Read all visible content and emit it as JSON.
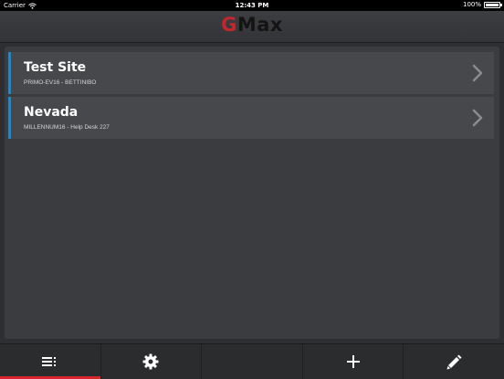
{
  "status_bar": {
    "carrier": "Carrier",
    "time": "12:43 PM",
    "battery": "100%"
  },
  "header": {
    "logo_first": "G",
    "logo_rest": "Max"
  },
  "sites": [
    {
      "name": "Test Site",
      "detail": "PRIMO-EV16 - BETTINIBO"
    },
    {
      "name": "Nevada",
      "detail": "MILLENNUM16 - Help Desk 227"
    }
  ],
  "tabbar": {
    "tabs": [
      {
        "icon": "list-icon",
        "active": true
      },
      {
        "icon": "gear-icon",
        "active": false
      },
      {
        "icon": "empty",
        "active": false
      },
      {
        "icon": "plus-icon",
        "active": false
      },
      {
        "icon": "pencil-icon",
        "active": false
      }
    ]
  },
  "colors": {
    "accent": "#1e88c9",
    "brand_red": "#c4262e",
    "active_tab": "#d8262e"
  }
}
